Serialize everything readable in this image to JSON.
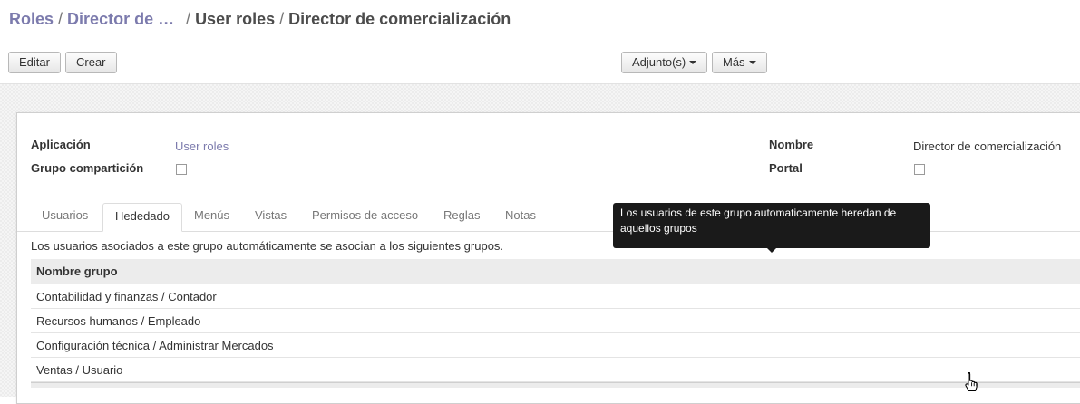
{
  "breadcrumb": {
    "items": [
      {
        "label": "Roles",
        "active": false
      },
      {
        "label": "Director de comercialización",
        "active": false
      },
      {
        "label": "User roles",
        "active": false
      },
      {
        "label": "Director de comercialización",
        "active": true
      }
    ],
    "separator": "/"
  },
  "toolbar": {
    "edit_label": "Editar",
    "create_label": "Crear",
    "attachments_label": "Adjunto(s)",
    "more_label": "Más"
  },
  "form": {
    "application_label": "Aplicación",
    "application_value": "User roles",
    "share_group_label": "Grupo compartición",
    "share_group_checked": false,
    "name_label": "Nombre",
    "name_value": "Director de comercialización",
    "portal_label": "Portal",
    "portal_checked": false
  },
  "tabs": [
    {
      "label": "Usuarios",
      "active": false
    },
    {
      "label": "Hededado",
      "active": true
    },
    {
      "label": "Menús",
      "active": false
    },
    {
      "label": "Vistas",
      "active": false
    },
    {
      "label": "Permisos de acceso",
      "active": false
    },
    {
      "label": "Reglas",
      "active": false
    },
    {
      "label": "Notas",
      "active": false
    }
  ],
  "inherited": {
    "help_text": "Los usuarios asociados a este grupo automáticamente se asocian a los siguientes grupos.",
    "column_header": "Nombre grupo",
    "rows": [
      "Contabilidad y finanzas / Contador",
      "Recursos humanos / Empleado",
      "Configuración técnica / Administrar Mercados",
      "Ventas / Usuario"
    ]
  },
  "tooltip": {
    "text": "Los usuarios de este grupo automaticamente heredan de aquellos grupos"
  },
  "colors": {
    "link": "#7c7bad",
    "tooltip_bg": "#1a1a1a"
  },
  "icons": {
    "cursor": "hand-pointer-icon",
    "dropdown": "caret-down-icon"
  }
}
